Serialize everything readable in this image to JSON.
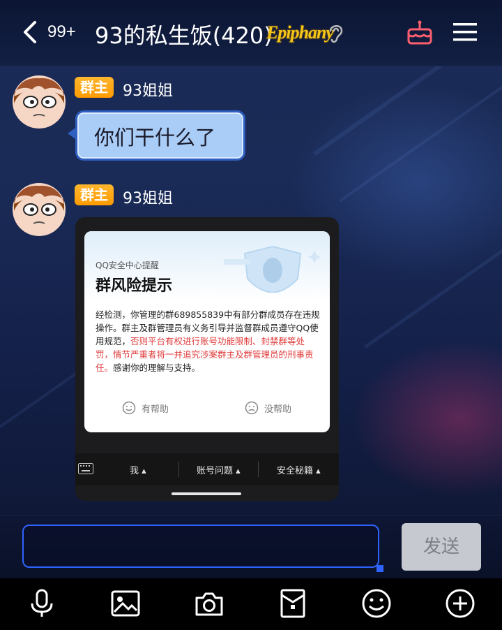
{
  "header": {
    "unread": "99+",
    "title": "93的私生饭(420)",
    "badge": "Epiphany"
  },
  "messages": [
    {
      "role": "群主",
      "sender": "93姐姐",
      "text": "你们干什么了"
    },
    {
      "role": "群主",
      "sender": "93姐姐"
    }
  ],
  "image_notice": {
    "source": "QQ安全中心提醒",
    "headline": "群风险提示",
    "body_normal": "经检测，你管理的群689855839中有部分群成员存在违规操作。群主及群管理员有义务引导并监督群成员遵守QQ使用规范，",
    "body_warning": "否则平台有权进行账号功能限制、封禁群等处罚，情节严重者将一并追究涉案群主及群管理员的刑事责任。",
    "body_end": "感谢你的理解与支持。",
    "helpful": "有帮助",
    "not_helpful": "没帮助",
    "nav": [
      "我",
      "账号问题",
      "安全秘籍"
    ]
  },
  "input": {
    "send_label": "发送"
  },
  "toolbar": [
    "microphone-icon",
    "image-icon",
    "camera-icon",
    "redpacket-icon",
    "emoji-icon",
    "plus-icon"
  ],
  "colors": {
    "accent": "#2f63ff",
    "role_badge": "#ff9b00",
    "warning": "#e03c3c",
    "bubble": "#a9cdf6"
  }
}
